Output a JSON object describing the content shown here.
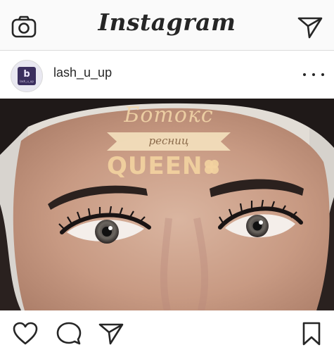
{
  "header": {
    "logo_text": "Instagram",
    "left_icon": "camera-icon",
    "right_icon": "direct-send-icon"
  },
  "post": {
    "username": "lash_u_up",
    "avatar_brand": "b",
    "avatar_brand_text": "lash_u_up",
    "more_icon": "more-options-icon",
    "watermark": {
      "title": "Ботокс",
      "subtitle": "ресниц",
      "tag": "QUEEN"
    }
  },
  "actions": {
    "icons": [
      "heart-icon",
      "comment-icon",
      "share-icon",
      "bookmark-icon"
    ]
  },
  "colors": {
    "text": "#262626",
    "border": "#dbdbdb",
    "topbar_bg": "#fafafa",
    "watermark": "#f3d6a8"
  }
}
